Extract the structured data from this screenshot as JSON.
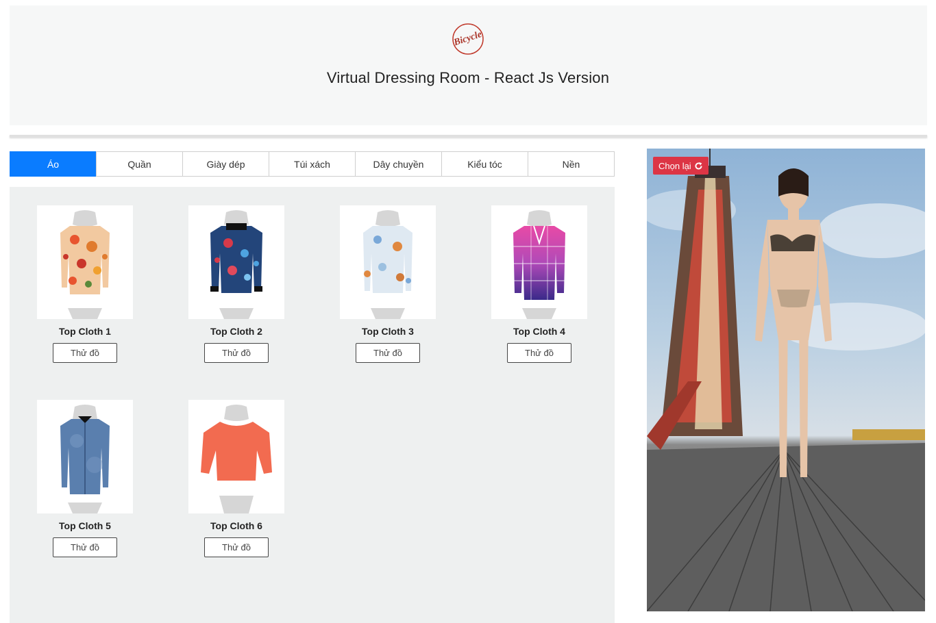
{
  "header": {
    "logo_text": "Bicycle",
    "title": "Virtual Dressing Room - React Js Version"
  },
  "tabs": [
    {
      "label": "Áo",
      "active": true
    },
    {
      "label": "Quần",
      "active": false
    },
    {
      "label": "Giày dép",
      "active": false
    },
    {
      "label": "Túi xách",
      "active": false
    },
    {
      "label": "Dây chuyền",
      "active": false
    },
    {
      "label": "Kiểu tóc",
      "active": false
    },
    {
      "label": "Nền",
      "active": false
    }
  ],
  "products": [
    {
      "name": "Top Cloth 1",
      "button": "Thử đồ",
      "style": "floral-orange"
    },
    {
      "name": "Top Cloth 2",
      "button": "Thử đồ",
      "style": "floral-blue"
    },
    {
      "name": "Top Cloth 3",
      "button": "Thử đồ",
      "style": "floral-white"
    },
    {
      "name": "Top Cloth 4",
      "button": "Thử đồ",
      "style": "plaid-pink-purple"
    },
    {
      "name": "Top Cloth 5",
      "button": "Thử đồ",
      "style": "denim-blue"
    },
    {
      "name": "Top Cloth 6",
      "button": "Thử đồ",
      "style": "coral-blouse"
    }
  ],
  "stage": {
    "reset_label": "Chọn lại",
    "reset_icon": "refresh-icon"
  },
  "colors": {
    "active_tab": "#0a7cff",
    "reset_button": "#dc3545",
    "panel_bg": "#eef0f0",
    "header_bg": "#f6f7f7"
  }
}
